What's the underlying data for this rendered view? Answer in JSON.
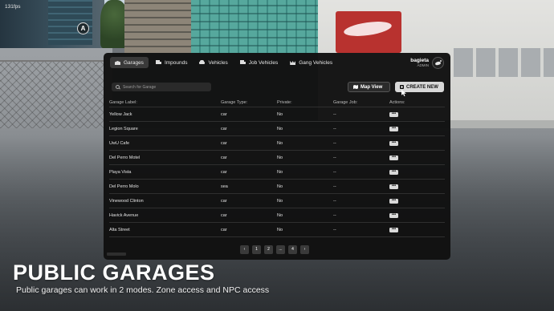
{
  "hud": {
    "fps": "131fps",
    "nav_letter": "A"
  },
  "tabs": [
    {
      "label": "Garages",
      "icon": "garage-icon",
      "active": true
    },
    {
      "label": "Impounds",
      "icon": "truck-icon",
      "active": false
    },
    {
      "label": "Vehicles",
      "icon": "car-icon",
      "active": false
    },
    {
      "label": "Job Vehicles",
      "icon": "truck-icon",
      "active": false
    },
    {
      "label": "Gang Vehicles",
      "icon": "crown-icon",
      "active": false
    }
  ],
  "user": {
    "name": "bagieta",
    "role": "ADMIN"
  },
  "search": {
    "placeholder": "Search for Garage"
  },
  "toolbar": {
    "map_label": "Map View",
    "create_label": "CREATE NEW"
  },
  "table": {
    "columns": [
      "Garage Label:",
      "Garage Type:",
      "Private:",
      "Garage Job:",
      "Actions:"
    ],
    "rows": [
      {
        "label": "Yellow Jack",
        "type": "car",
        "private": "No",
        "job": "--",
        "action": "•••"
      },
      {
        "label": "Legion Square",
        "type": "car",
        "private": "No",
        "job": "--",
        "action": "•••"
      },
      {
        "label": "UwU Cafe",
        "type": "car",
        "private": "No",
        "job": "--",
        "action": "•••"
      },
      {
        "label": "Del Perro Motel",
        "type": "car",
        "private": "No",
        "job": "--",
        "action": "•••"
      },
      {
        "label": "Playa Vista",
        "type": "car",
        "private": "No",
        "job": "--",
        "action": "•••"
      },
      {
        "label": "Del Perro Molo",
        "type": "sea",
        "private": "No",
        "job": "--",
        "action": "•••"
      },
      {
        "label": "Vinewood Clinton",
        "type": "car",
        "private": "No",
        "job": "--",
        "action": "•••"
      },
      {
        "label": "Havick Avenue",
        "type": "car",
        "private": "No",
        "job": "--",
        "action": "•••"
      },
      {
        "label": "Alta Street",
        "type": "car",
        "private": "No",
        "job": "--",
        "action": "•••"
      }
    ]
  },
  "pagination": {
    "prev": "‹",
    "pages": [
      "1",
      "2",
      "...",
      "4"
    ],
    "next": "›"
  },
  "caption": {
    "title": "PUBLIC GARAGES",
    "subtitle": "Public garages can work in 2 modes. Zone access and NPC access"
  }
}
